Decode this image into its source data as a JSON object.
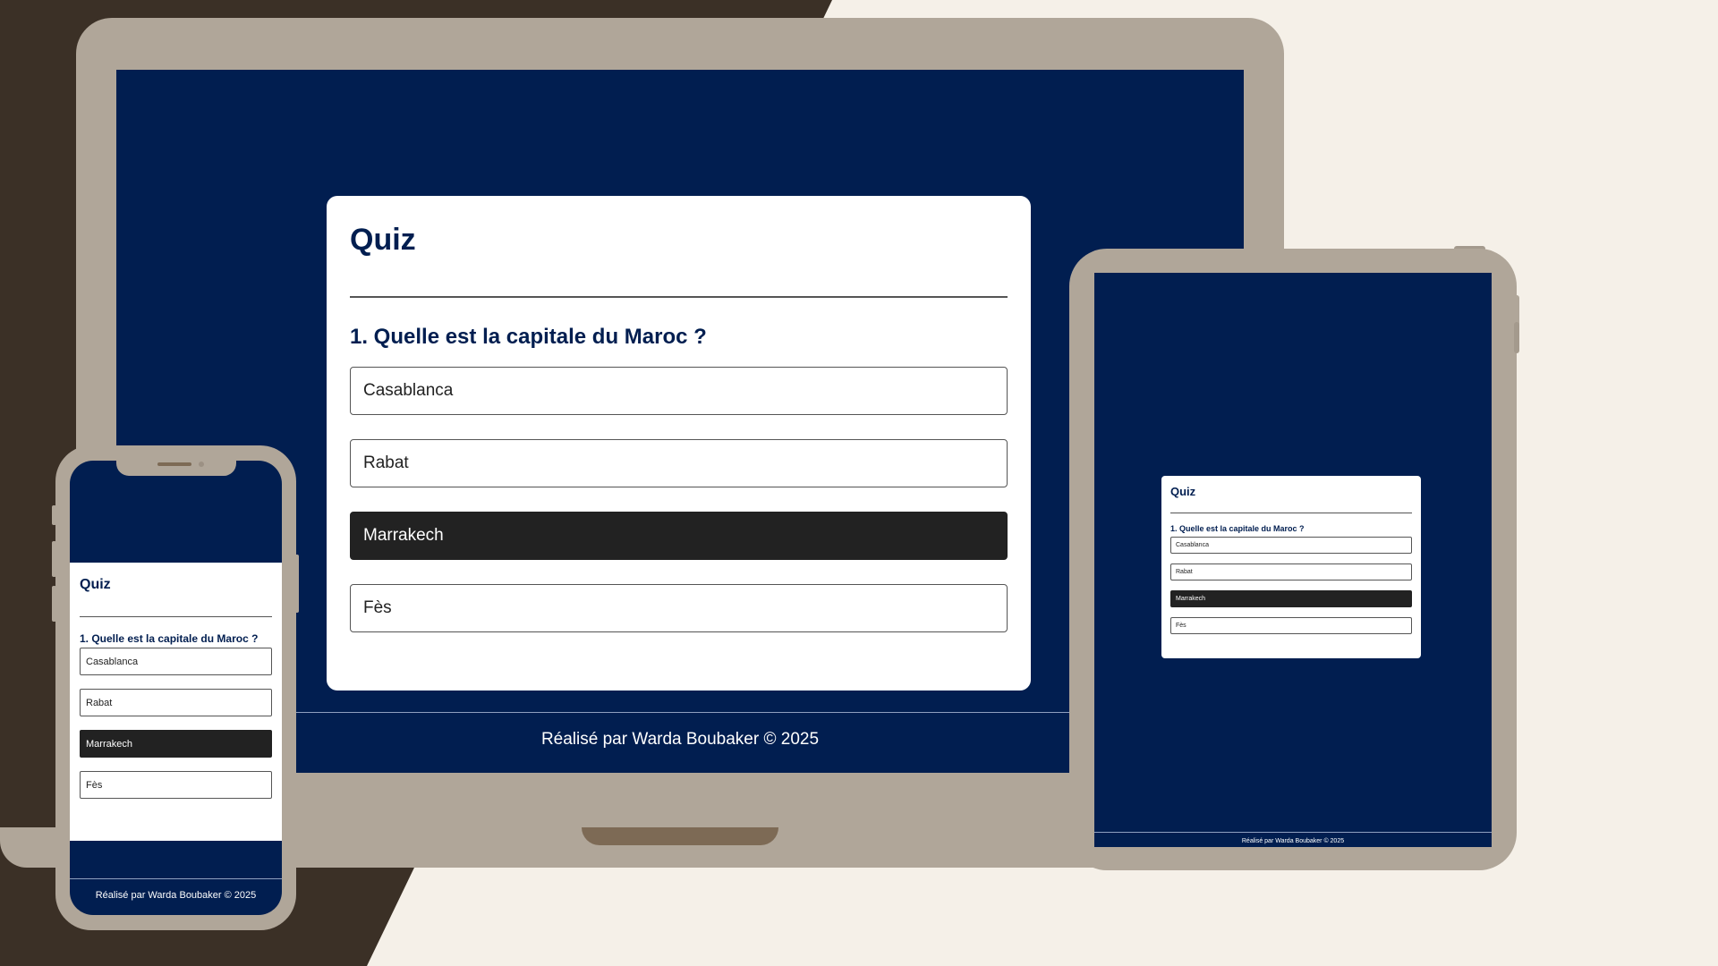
{
  "quiz": {
    "title": "Quiz",
    "question": "1. Quelle est la capitale du Maroc ?",
    "options": [
      "Casablanca",
      "Rabat",
      "Marrakech",
      "Fès"
    ],
    "selected_index": 2
  },
  "footer": {
    "text": "Réalisé par Warda Boubaker © 2025"
  },
  "colors": {
    "page_bg_light": "#f5f0e8",
    "page_bg_dark": "#3b3026",
    "device_frame": "#b0a699",
    "screen_bg": "#011e50",
    "title_color": "#011e50",
    "selected_option": "#222222"
  }
}
